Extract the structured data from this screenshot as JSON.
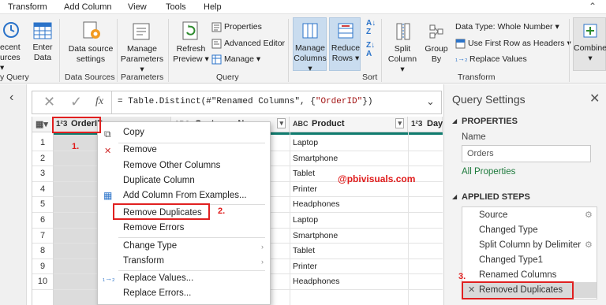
{
  "menubar": {
    "items": [
      "Transform",
      "Add Column",
      "View",
      "Tools",
      "Help"
    ]
  },
  "ribbon": {
    "recent_sources": [
      "ecent",
      "urces"
    ],
    "enter_data": [
      "Enter",
      "Data"
    ],
    "data_source_settings": [
      "Data source",
      "settings"
    ],
    "manage_parameters": [
      "Manage",
      "Parameters"
    ],
    "refresh_preview": [
      "Refresh",
      "Preview"
    ],
    "properties": "Properties",
    "advanced_editor": "Advanced Editor",
    "manage": "Manage",
    "manage_columns": [
      "Manage",
      "Columns"
    ],
    "reduce_rows": [
      "Reduce",
      "Rows"
    ],
    "split_column": [
      "Split",
      "Column"
    ],
    "group_by": [
      "Group",
      "By"
    ],
    "data_type": "Data Type: Whole Number",
    "use_first_row": "Use First Row as Headers",
    "replace_values": "Replace Values",
    "combine": "Combine",
    "groups": {
      "query_left": "y Query",
      "data_sources": "Data Sources",
      "parameters": "Parameters",
      "query": "Query",
      "sort": "Sort",
      "transform": "Transform"
    }
  },
  "formula": {
    "text_prefix": "= Table.Distinct(#\"Renamed Columns\", {",
    "text_str": "\"OrderID\"",
    "text_suffix": "})"
  },
  "grid": {
    "col_orderid": "OrderID",
    "col_customer": "Customer Na",
    "col_product": "Product",
    "col_day": "Day",
    "type_num": "1²3",
    "type_abc": "ABC",
    "rows": [
      "1",
      "2",
      "3",
      "4",
      "5",
      "6",
      "7",
      "8",
      "9",
      "10"
    ],
    "products": [
      "Laptop",
      "Smartphone",
      "Tablet",
      "Printer",
      "Headphones",
      "Laptop",
      "Smartphone",
      "Tablet",
      "Printer",
      "Headphones"
    ]
  },
  "context_menu": {
    "copy": "Copy",
    "remove": "Remove",
    "remove_other": "Remove Other Columns",
    "duplicate": "Duplicate Column",
    "add_from_examples": "Add Column From Examples...",
    "remove_duplicates": "Remove Duplicates",
    "remove_errors": "Remove Errors",
    "change_type": "Change Type",
    "transform": "Transform",
    "replace_values": "Replace Values...",
    "replace_errors": "Replace Errors..."
  },
  "annotations": {
    "a1": "1.",
    "a2": "2.",
    "a3": "3.",
    "watermark": "@pbivisuals.com"
  },
  "query_settings": {
    "title": "Query Settings",
    "properties": "PROPERTIES",
    "name_label": "Name",
    "name_value": "Orders",
    "all_properties": "All Properties",
    "applied_steps": "APPLIED STEPS",
    "steps": [
      "Source",
      "Changed Type",
      "Split Column by Delimiter",
      "Changed Type1",
      "Renamed Columns",
      "Removed Duplicates"
    ]
  },
  "colors": {
    "accent": "#107c6f",
    "red": "#e01b1b",
    "link": "#1d7a3c"
  }
}
